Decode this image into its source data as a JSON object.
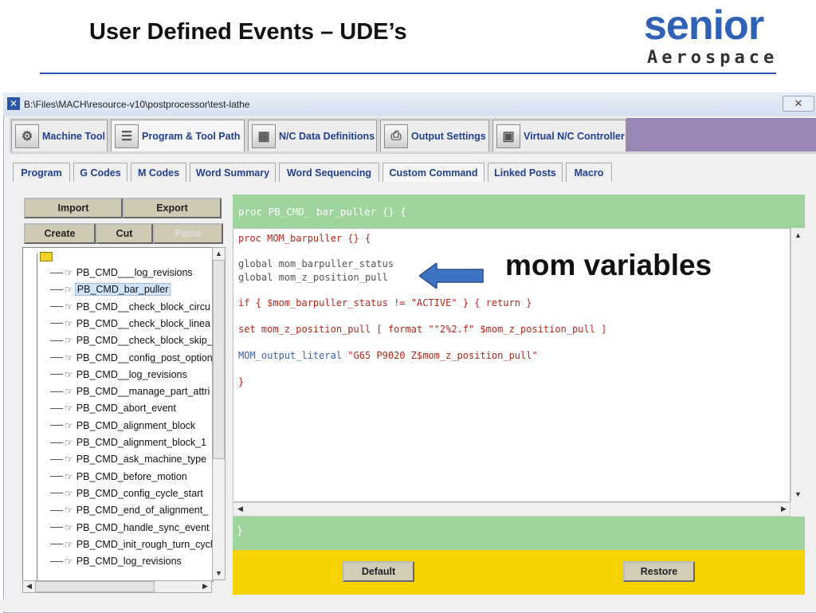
{
  "slide": {
    "title": "User Defined Events – UDE’s",
    "logo_main": "senior",
    "logo_sub": "Aerospace"
  },
  "window": {
    "title": "B:\\Files\\MACH\\resource-v10\\postprocessor\\test-lathe",
    "close_glyph": "✕"
  },
  "main_tabs": [
    {
      "label": "Machine Tool",
      "icon": "machine-tool-icon"
    },
    {
      "label": "Program & Tool Path",
      "icon": "program-icon"
    },
    {
      "label": "N/C Data Definitions",
      "icon": "nc-data-icon"
    },
    {
      "label": "Output Settings",
      "icon": "printer-icon"
    },
    {
      "label": "Virtual N/C Controller",
      "icon": "controller-icon"
    }
  ],
  "sub_tabs": [
    "Program",
    "G Codes",
    "M Codes",
    "Word Summary",
    "Word Sequencing",
    "Custom Command",
    "Linked Posts",
    "Macro"
  ],
  "left_buttons": {
    "import": "Import",
    "export": "Export",
    "create": "Create",
    "cut": "Cut",
    "paste": "Paste"
  },
  "tree_items": [
    "PB_CMD___log_revisions",
    "PB_CMD_bar_puller",
    "PB_CMD__check_block_circu",
    "PB_CMD__check_block_linea",
    "PB_CMD__check_block_skip_",
    "PB_CMD__config_post_option",
    "PB_CMD__log_revisions",
    "PB_CMD__manage_part_attri",
    "PB_CMD_abort_event",
    "PB_CMD_alignment_block",
    "PB_CMD_alignment_block_1",
    "PB_CMD_ask_machine_type",
    "PB_CMD_before_motion",
    "PB_CMD_config_cycle_start",
    "PB_CMD_end_of_alignment_",
    "PB_CMD_handle_sync_event",
    "PB_CMD_init_rough_turn_cycl",
    "PB_CMD_log_revisions"
  ],
  "selected_item_index": 1,
  "editor": {
    "header": "proc  PB_CMD_ bar_puller  {} {",
    "footer": "}",
    "lines": {
      "l1": "proc MOM_barpuller {} {",
      "l2": "global mom_barpuller_status",
      "l3": "global mom_z_position_pull",
      "l4a": "if { $mom_barpuller_status != ",
      "l4b": "\"ACTIVE\"",
      "l4c": " } { return }",
      "l5a": "set mom_z_position_pull [ format \"",
      "l5b": "\"2%2.f\"",
      "l5c": " $mom_z_position_pull ]",
      "l6a": "MOM_output_literal ",
      "l6b": "\"G65 P9020 Z$mom_z_position_pull\"",
      "l7": "}"
    }
  },
  "bottom_buttons": {
    "default": "Default",
    "restore": "Restore"
  },
  "annotation": "mom variables",
  "colors": {
    "accent": "#2e56b8",
    "green_panel": "#9fd49d",
    "yellow_panel": "#f5d200",
    "string_red": "#b8271c",
    "arrow_fill": "#3f74c4"
  }
}
